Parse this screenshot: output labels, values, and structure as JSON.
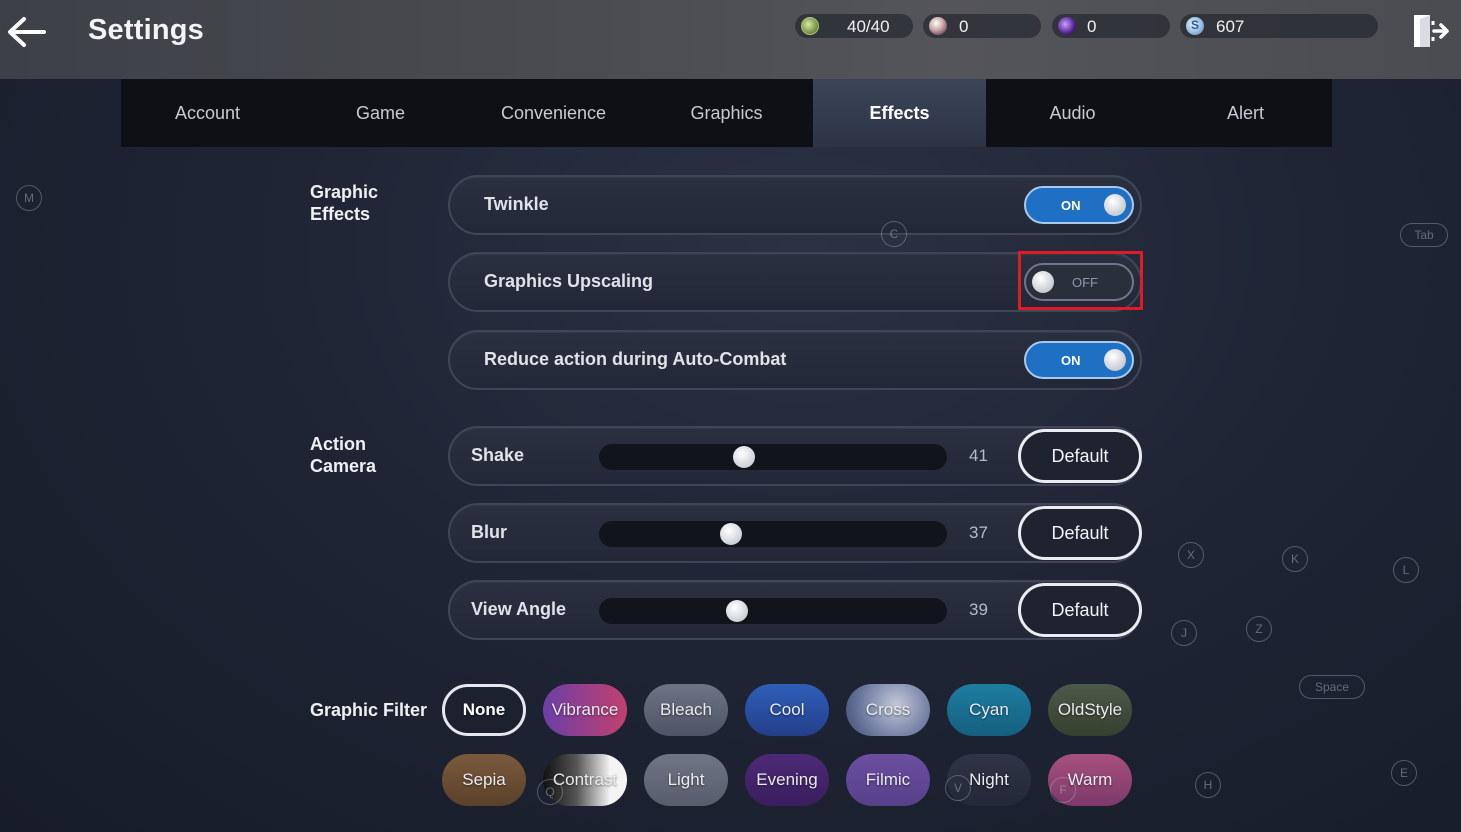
{
  "header": {
    "title": "Settings",
    "back_icon": "arrow-left-icon",
    "exit_icon": "exit-door-icon"
  },
  "currencies": [
    {
      "icon": "stamina-gem-icon",
      "value": "40/40"
    },
    {
      "icon": "pearl-icon",
      "value": "0"
    },
    {
      "icon": "purple-orb-icon",
      "value": "0"
    },
    {
      "icon": "silver-coin-icon",
      "value": "607"
    }
  ],
  "tabs": [
    {
      "label": "Account"
    },
    {
      "label": "Game"
    },
    {
      "label": "Convenience"
    },
    {
      "label": "Graphics"
    },
    {
      "label": "Effects",
      "active": true
    },
    {
      "label": "Audio"
    },
    {
      "label": "Alert"
    }
  ],
  "graphic_effects": {
    "section_label_line1": "Graphic",
    "section_label_line2": "Effects",
    "rows": [
      {
        "label": "Twinkle",
        "state": "ON",
        "on": true
      },
      {
        "label": "Graphics Upscaling",
        "state": "OFF",
        "on": false
      },
      {
        "label": "Reduce action during Auto-Combat",
        "state": "ON",
        "on": true
      }
    ]
  },
  "action_camera": {
    "section_label_line1": "Action",
    "section_label_line2": "Camera",
    "rows": [
      {
        "label": "Shake",
        "value": "41",
        "button": "Default"
      },
      {
        "label": "Blur",
        "value": "37",
        "button": "Default"
      },
      {
        "label": "View Angle",
        "value": "39",
        "button": "Default"
      }
    ]
  },
  "graphic_filter": {
    "section_label": "Graphic Filter",
    "selected": "None",
    "filters": [
      {
        "label": "None"
      },
      {
        "label": "Vibrance"
      },
      {
        "label": "Bleach"
      },
      {
        "label": "Cool"
      },
      {
        "label": "Cross"
      },
      {
        "label": "Cyan"
      },
      {
        "label": "OldStyle"
      },
      {
        "label": "Sepia"
      },
      {
        "label": "Contrast"
      },
      {
        "label": "Light"
      },
      {
        "label": "Evening"
      },
      {
        "label": "Filmic"
      },
      {
        "label": "Night"
      },
      {
        "label": "Warm"
      }
    ]
  },
  "key_hints": [
    "M",
    "C",
    "Tab",
    "X",
    "K",
    "L",
    "J",
    "Z",
    "Space",
    "H",
    "E",
    "Q",
    "V",
    "F"
  ],
  "colors": {
    "toggle_on": "#1f6fc4",
    "highlight": "#e01b24",
    "active_tab": "#3c4558"
  }
}
